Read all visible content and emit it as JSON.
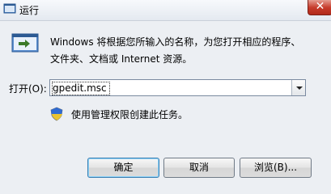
{
  "window": {
    "title": "运行",
    "close_label": "✕"
  },
  "description": {
    "line1": "Windows 将根据您所输入的名称，为您打开相应的程序、",
    "line2": "文件夹、文档或 Internet 资源。"
  },
  "open_field": {
    "label": "打开(O):",
    "value": "gpedit.msc"
  },
  "admin_note": "使用管理权限创建此任务。",
  "buttons": {
    "ok": "确定",
    "cancel": "取消",
    "browse": "浏览(B)..."
  },
  "colors": {
    "close_button": "#c63b2b",
    "default_button_border": "#3c7fb1"
  }
}
